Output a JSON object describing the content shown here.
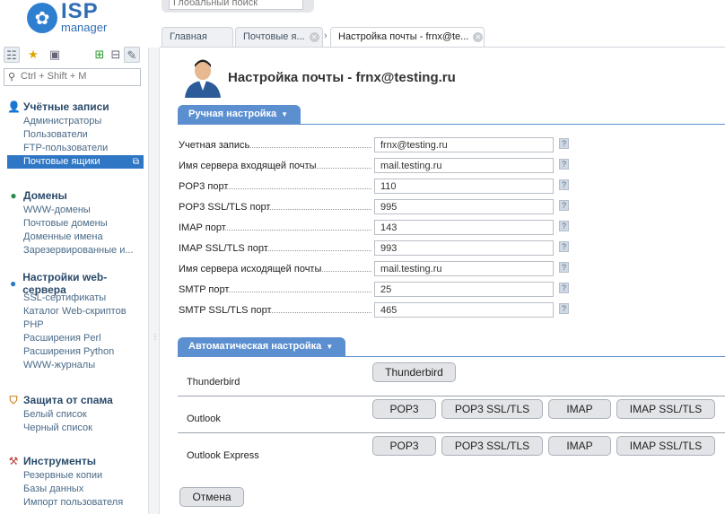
{
  "logo": {
    "brand": "ISP",
    "sub": "manager"
  },
  "global_search": {
    "placeholder": "Глобальный поиск"
  },
  "tabs": [
    {
      "label": "Главная"
    },
    {
      "label": "Почтовые я..."
    },
    {
      "label": "Настройка почты - frnx@te..."
    }
  ],
  "sidebar": {
    "search_placeholder": "Ctrl + Shift + M",
    "groups": [
      {
        "title": "Учётные записи",
        "items": [
          "Администраторы",
          "Пользователи",
          "FTP-пользователи",
          "Почтовые ящики"
        ]
      },
      {
        "title": "Домены",
        "items": [
          "WWW-домены",
          "Почтовые домены",
          "Доменные имена",
          "Зарезервированные и..."
        ]
      },
      {
        "title": "Настройки web-сервера",
        "items": [
          "SSL-сертификаты",
          "Каталог Web-скриптов",
          "PHP",
          "Расширения Perl",
          "Расширения Python",
          "WWW-журналы"
        ]
      },
      {
        "title": "Защита от спама",
        "items": [
          "Белый список",
          "Черный список"
        ]
      },
      {
        "title": "Инструменты",
        "items": [
          "Резервные копии",
          "Базы данных",
          "Импорт пользователя"
        ]
      }
    ]
  },
  "main": {
    "title": "Настройка почты - frnx@testing.ru",
    "manual_section": "Ручная настройка",
    "fields": [
      {
        "label": "Учетная запись",
        "value": "frnx@testing.ru"
      },
      {
        "label": "Имя сервера входящей почты",
        "value": "mail.testing.ru"
      },
      {
        "label": "POP3 порт",
        "value": "110"
      },
      {
        "label": "POP3 SSL/TLS порт",
        "value": "995"
      },
      {
        "label": "IMAP порт",
        "value": "143"
      },
      {
        "label": "IMAP SSL/TLS порт",
        "value": "993"
      },
      {
        "label": "Имя сервера исходящей почты",
        "value": "mail.testing.ru"
      },
      {
        "label": "SMTP порт",
        "value": "25"
      },
      {
        "label": "SMTP SSL/TLS порт",
        "value": "465"
      }
    ],
    "help_glyph": "?",
    "auto_section": "Автоматическая настройка",
    "clients": [
      {
        "name": "Thunderbird",
        "buttons": [
          "Thunderbird"
        ]
      },
      {
        "name": "Outlook",
        "buttons": [
          "POP3",
          "POP3 SSL/TLS",
          "IMAP",
          "IMAP SSL/TLS"
        ]
      },
      {
        "name": "Outlook Express",
        "buttons": [
          "POP3",
          "POP3 SSL/TLS",
          "IMAP",
          "IMAP SSL/TLS"
        ]
      }
    ],
    "cancel_label": "Отмена"
  },
  "colors": {
    "accent": "#5b8fd0",
    "sidebar_active": "#2f77c4",
    "link": "#4a6a88"
  }
}
